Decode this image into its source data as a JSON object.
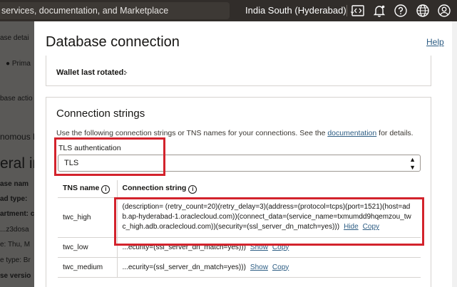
{
  "topbar": {
    "search_text": "services, documentation, and Marketplace",
    "region": "India South (Hyderabad)",
    "icons": [
      "code-editor-icon",
      "bell-icon",
      "help-icon",
      "globe-icon",
      "user-icon"
    ]
  },
  "background": {
    "lines": [
      "ase detai",
      "Prima",
      "base actio",
      "nomous D",
      "eral ir",
      "ase nam",
      "ad type:",
      "artment: c",
      "...z3dosa",
      "e: Thu, M",
      "e type: Br",
      "se versio"
    ]
  },
  "drawer": {
    "title": "Database connection",
    "help_label": "Help",
    "wallet_label": "Wallet last rotated:",
    "wallet_value": "-",
    "cs_title": "Connection strings",
    "cs_desc_before": "Use the following connection strings or TNS names for your connections. See the ",
    "cs_desc_link": "documentation",
    "cs_desc_after": " for details.",
    "tls_label": "TLS authentication",
    "tls_value": "TLS",
    "table": {
      "headers": [
        "TNS name",
        "Connection string"
      ],
      "rows": [
        {
          "name": "twc_high",
          "lines": [
            "(description= (retry_count=20)(retry_delay=3)(address=(protocol=tcps)(port=1521)(host=ad",
            "b.ap-hyderabad-1.oraclecloud.com))(connect_data=(service_name=txmumdd9hqemzou_tw",
            "c_high.adb.oraclecloud.com))(security=(ssl_server_dn_match=yes)))"
          ],
          "action1": "Hide",
          "action2": "Copy"
        },
        {
          "name": "twc_low",
          "lines": [
            "...ecurity=(ssl_server_dn_match=yes)))"
          ],
          "action1": "Show",
          "action2": "Copy"
        },
        {
          "name": "twc_medium",
          "lines": [
            "...ecurity=(ssl_server_dn_match=yes)))"
          ],
          "action1": "Show",
          "action2": "Copy"
        }
      ]
    }
  },
  "colors": {
    "topbar": "#312d2a",
    "link": "#2c5c83",
    "highlight": "#d3232c"
  }
}
